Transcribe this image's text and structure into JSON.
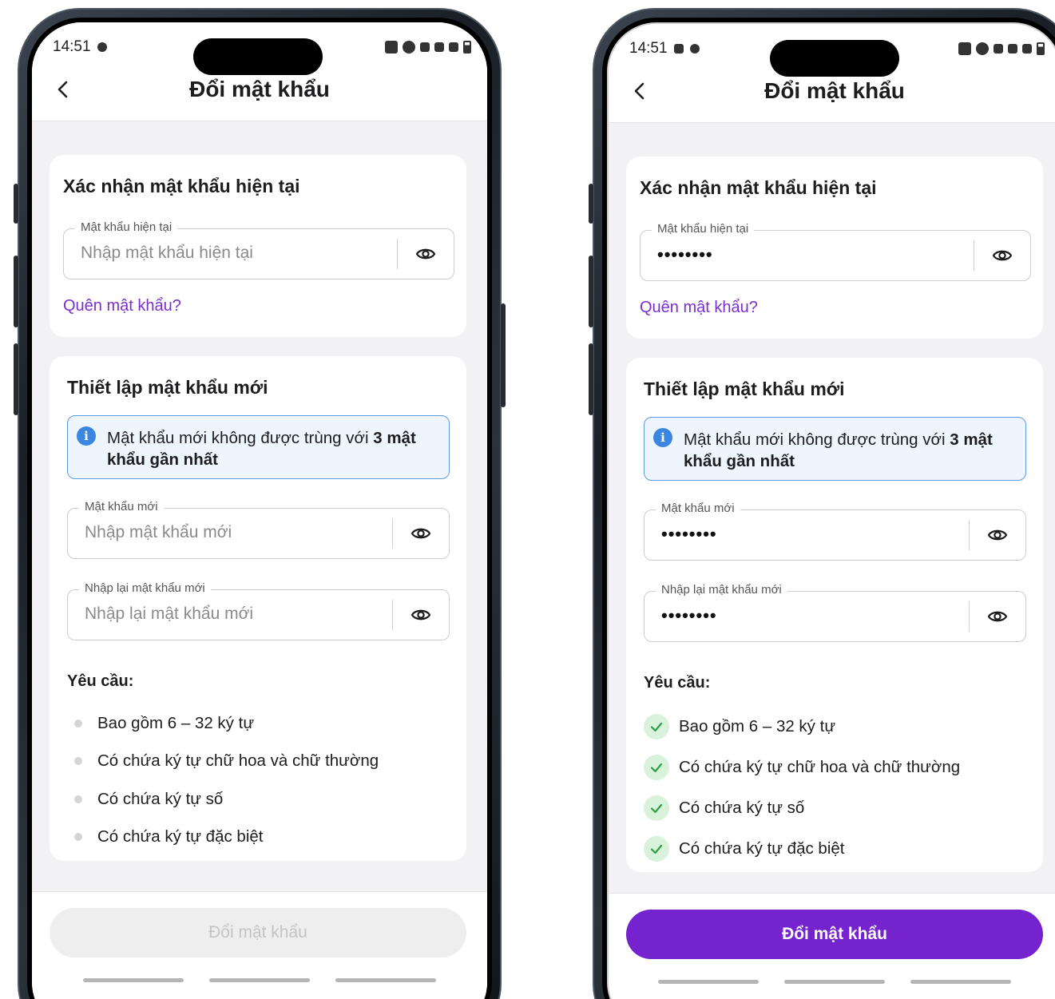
{
  "status_time": "14:51",
  "title": "Đổi mật khẩu",
  "current_section": {
    "title": "Xác nhận mật khẩu hiện tại",
    "field_label": "Mật khẩu hiện tại",
    "placeholder": "Nhập mật khẩu hiện tại",
    "forgot_link": "Quên mật khẩu?"
  },
  "new_section": {
    "title": "Thiết lập mật khẩu mới",
    "info_text": "Mật khẩu mới không được trùng với",
    "info_bold": "3 mật khẩu gần nhất",
    "new_field_label": "Mật khẩu mới",
    "new_placeholder": "Nhập mật khẩu mới",
    "confirm_field_label": "Nhập lại mật khẩu mới",
    "confirm_placeholder": "Nhập lại mật khẩu mới"
  },
  "requirements": {
    "title": "Yêu cầu:",
    "items": [
      "Bao gồm 6 – 32 ký tự",
      "Có chứa ký tự chữ hoa và chữ thường",
      "Có chứa ký tự số",
      "Có chứa ký tự đặc biệt"
    ]
  },
  "masked_value": "••••••••",
  "submit_label": "Đổi mật khẩu",
  "colors": {
    "accent": "#7523cf",
    "link": "#7a2ed0",
    "info_border": "#5b9be6",
    "check_bg": "#d8f2dc",
    "check": "#2e9e46"
  },
  "icons": [
    "back-icon",
    "eye-icon",
    "info-icon",
    "check-icon"
  ]
}
